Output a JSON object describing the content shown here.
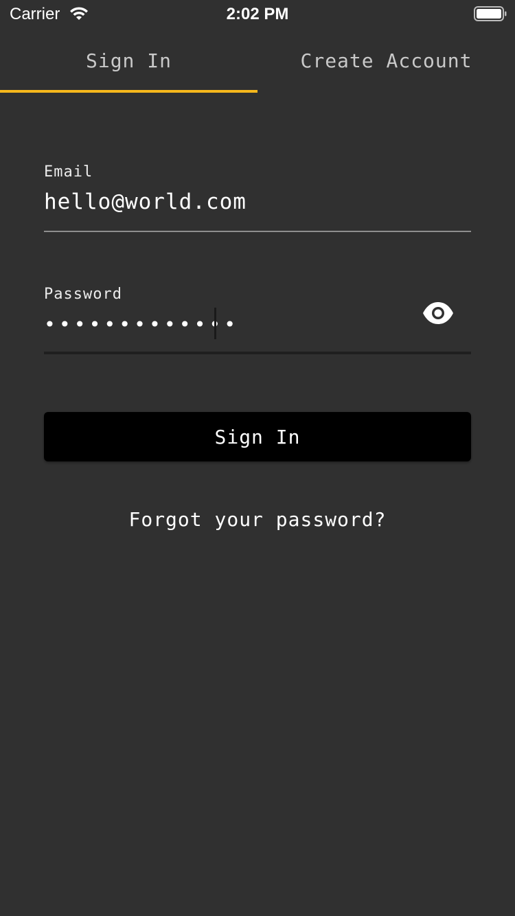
{
  "status_bar": {
    "carrier": "Carrier",
    "time": "2:02 PM",
    "wifi_icon": "wifi-icon",
    "battery_icon": "battery-icon"
  },
  "tabs": [
    {
      "label": "Sign In",
      "active": true
    },
    {
      "label": "Create Account",
      "active": false
    }
  ],
  "form": {
    "email": {
      "label": "Email",
      "value": "hello@world.com"
    },
    "password": {
      "label": "Password",
      "value_masked": "•••••••••••••",
      "toggle_icon": "eye-icon"
    },
    "submit_label": "Sign In",
    "forgot_label": "Forgot your password?"
  },
  "colors": {
    "background": "#303030",
    "accent": "#f5b71c",
    "button": "#000000"
  }
}
